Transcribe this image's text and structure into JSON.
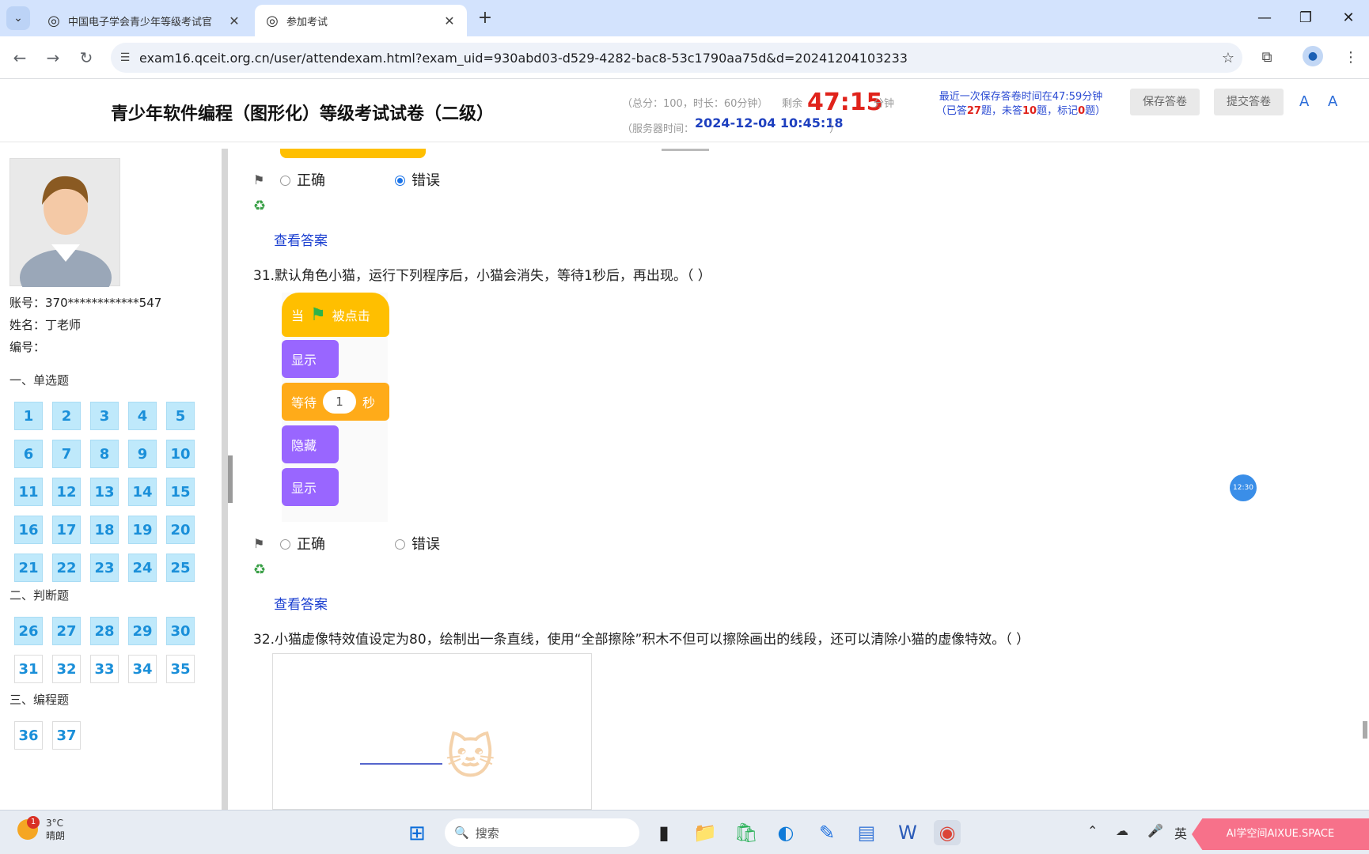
{
  "browser": {
    "tabs": [
      {
        "title": "中国电子学会青少年等级考试官",
        "active": false
      },
      {
        "title": "参加考试",
        "active": true
      }
    ],
    "url": "exam16.qceit.org.cn/user/attendexam.html?exam_uid=930abd03-d529-4282-bac8-53c1790aa75d&d=20241204103233"
  },
  "header": {
    "title": "青少年软件编程（图形化）等级考试试卷（二级）",
    "score_info": "（总分：100，时长：60分钟）",
    "remaining_label": "剩余",
    "remaining_time": "47:15",
    "remaining_unit": "分钟",
    "server_time_label": "（服务器时间：",
    "server_time": "2024-12-04 10:45:18",
    "server_time_close": "）",
    "last_save": "最近一次保存答卷时间在47:59分钟",
    "progress_prefix": "（已答",
    "answered": "27",
    "progress_mid1": "题，未答",
    "unanswered": "10",
    "progress_mid2": "题，标记",
    "marked": "0",
    "progress_suffix": "题）",
    "save_button": "保存答卷",
    "submit_button": "提交答卷"
  },
  "user": {
    "account_label": "账号：",
    "account": "370************547",
    "name_label": "姓名：",
    "name": "丁老师",
    "id_label": "编号："
  },
  "sections": [
    {
      "title": "一、单选题",
      "questions": [
        "1",
        "2",
        "3",
        "4",
        "5",
        "6",
        "7",
        "8",
        "9",
        "10",
        "11",
        "12",
        "13",
        "14",
        "15",
        "16",
        "17",
        "18",
        "19",
        "20",
        "21",
        "22",
        "23",
        "24",
        "25"
      ]
    },
    {
      "title": "二、判断题",
      "questions": [
        "26",
        "27",
        "28",
        "29",
        "30",
        "31",
        "32",
        "33",
        "34",
        "35"
      ]
    },
    {
      "title": "三、编程题",
      "questions": [
        "36",
        "37"
      ]
    }
  ],
  "main": {
    "option_true": "正确",
    "option_false": "错误",
    "view_answer": "查看答案",
    "q31_text": "31.默认角色小猫，运行下列程序后，小猫会消失，等待1秒后，再出现。（ ）",
    "q32_text": "32.小猫虚像特效值设定为80，绘制出一条直线，使用“全部擦除”积木不但可以擦除画出的线段，还可以清除小猫的虚像特效。（ ）",
    "blocks": {
      "when_flag_pre": "当",
      "when_flag_post": "被点击",
      "show": "显示",
      "wait_pre": "等待",
      "wait_value": "1",
      "wait_post": "秒",
      "hide": "隐藏",
      "show2": "显示"
    },
    "clock_badge": "12:30"
  },
  "taskbar": {
    "weather_temp": "3°C",
    "weather_desc": "晴朗",
    "weather_badge": "1",
    "search_placeholder": "搜索",
    "ime": "英",
    "promo": "AI学空间AIXUE.SPACE"
  }
}
